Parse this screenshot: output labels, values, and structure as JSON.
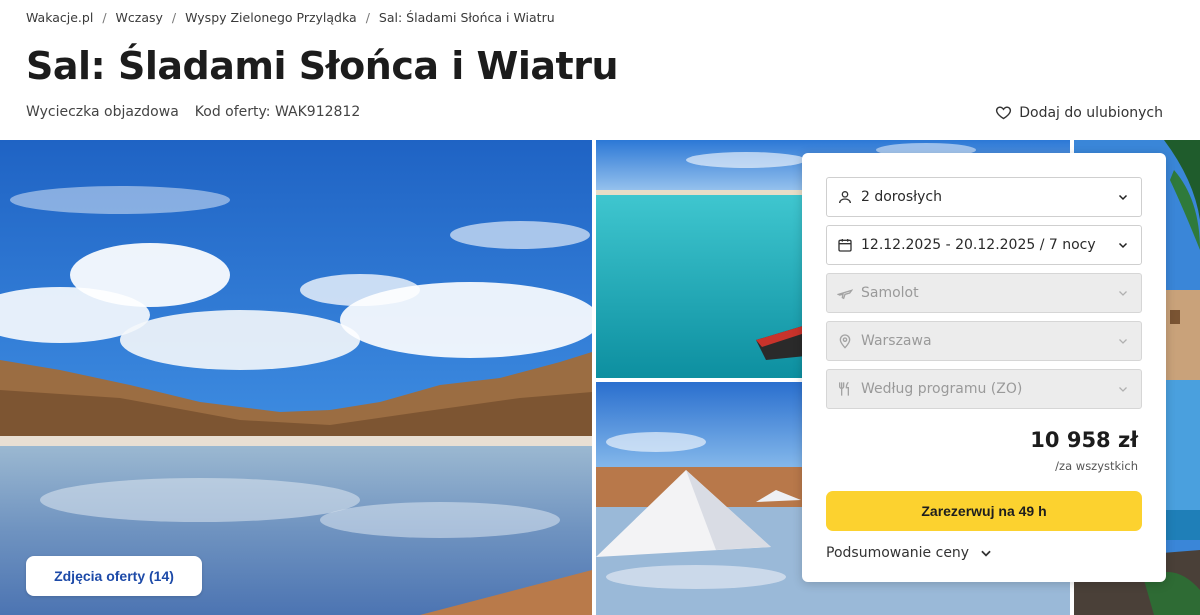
{
  "breadcrumb": [
    "Wakacje.pl",
    "Wczasy",
    "Wyspy Zielonego Przylądka",
    "Sal: Śladami Słońca i Wiatru"
  ],
  "title": "Sal: Śladami Słońca i Wiatru",
  "meta": {
    "type": "Wycieczka objazdowa",
    "offer_code": "Kod oferty: WAK912812"
  },
  "favorite_label": "Dodaj do ulubionych",
  "gallery": {
    "photos_button": "Zdjęcia oferty (14)"
  },
  "booking": {
    "travelers": {
      "value": "2 dorosłych",
      "icon": "person-icon"
    },
    "dates": {
      "value": "12.12.2025 - 20.12.2025 / 7 nocy",
      "icon": "calendar-icon"
    },
    "transport": {
      "value": "Samolot",
      "icon": "plane-icon"
    },
    "departure": {
      "value": "Warszawa",
      "icon": "location-pin-icon"
    },
    "board": {
      "value": "Według programu (ZO)",
      "icon": "cutlery-icon"
    },
    "price": "10 958 zł",
    "price_note": "/za wszystkich",
    "reserve_label": "Zarezerwuj na 49 h",
    "summary_label": "Podsumowanie ceny"
  },
  "colors": {
    "accent_yellow": "#fcd22f",
    "link_blue": "#1d4aa8",
    "disabled_field": "#ececec"
  }
}
